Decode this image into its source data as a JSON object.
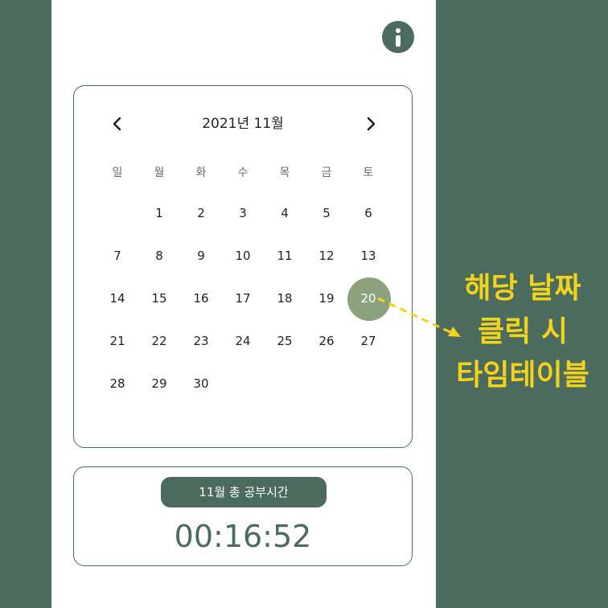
{
  "calendar": {
    "title": "2021년 11월",
    "weekdays": [
      "일",
      "월",
      "화",
      "수",
      "목",
      "금",
      "토"
    ],
    "days": [
      [
        "",
        "1",
        "2",
        "3",
        "4",
        "5",
        "6"
      ],
      [
        "7",
        "8",
        "9",
        "10",
        "11",
        "12",
        "13"
      ],
      [
        "14",
        "15",
        "16",
        "17",
        "18",
        "19",
        "20"
      ],
      [
        "21",
        "22",
        "23",
        "24",
        "25",
        "26",
        "27"
      ],
      [
        "28",
        "29",
        "30",
        "",
        "",
        "",
        ""
      ]
    ],
    "selected_day": "20"
  },
  "summary": {
    "label": "11월 총 공부시간",
    "time": "00:16:52"
  },
  "annotation": {
    "lines": [
      "해당 날짜",
      "클릭 시",
      "타임테이블"
    ]
  },
  "colors": {
    "primary": "#4a6b5e",
    "selected": "#8ca27f",
    "annotation": "#f2d31b"
  },
  "icons": {
    "info": "info-icon",
    "prev": "chevron-left-icon",
    "next": "chevron-right-icon"
  }
}
